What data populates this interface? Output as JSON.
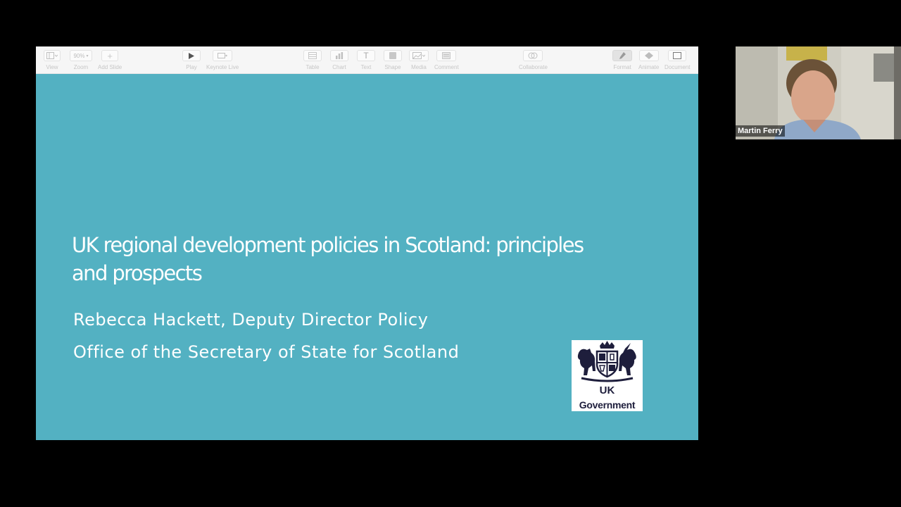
{
  "toolbar": {
    "view": "View",
    "zoom_value": "90%",
    "zoom": "Zoom",
    "add_slide": "Add Slide",
    "play": "Play",
    "keynote_live": "Keynote Live",
    "table": "Table",
    "chart": "Chart",
    "text": "Text",
    "shape": "Shape",
    "media": "Media",
    "comment": "Comment",
    "collaborate": "Collaborate",
    "format": "Format",
    "animate": "Animate",
    "document": "Document"
  },
  "slide": {
    "title_line1": "UK regional development policies in Scotland: principles",
    "title_line2": "and prospects",
    "presenter": "Rebecca Hackett, Deputy Director Policy",
    "organisation": "Office of the Secretary of State for Scotland",
    "background_color": "#53b1c2",
    "logo": {
      "line1": "UK",
      "line2": "Government"
    }
  },
  "participant": {
    "name": "Martin Ferry"
  }
}
